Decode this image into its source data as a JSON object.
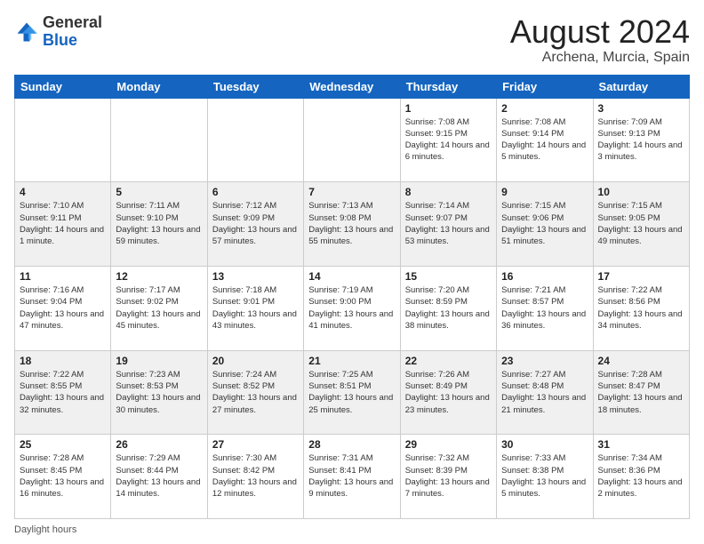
{
  "header": {
    "logo_general": "General",
    "logo_blue": "Blue",
    "month_year": "August 2024",
    "location": "Archena, Murcia, Spain"
  },
  "footer": {
    "daylight_label": "Daylight hours"
  },
  "weekdays": [
    "Sunday",
    "Monday",
    "Tuesday",
    "Wednesday",
    "Thursday",
    "Friday",
    "Saturday"
  ],
  "weeks": [
    [
      {
        "day": "",
        "info": ""
      },
      {
        "day": "",
        "info": ""
      },
      {
        "day": "",
        "info": ""
      },
      {
        "day": "",
        "info": ""
      },
      {
        "day": "1",
        "info": "Sunrise: 7:08 AM\nSunset: 9:15 PM\nDaylight: 14 hours\nand 6 minutes."
      },
      {
        "day": "2",
        "info": "Sunrise: 7:08 AM\nSunset: 9:14 PM\nDaylight: 14 hours\nand 5 minutes."
      },
      {
        "day": "3",
        "info": "Sunrise: 7:09 AM\nSunset: 9:13 PM\nDaylight: 14 hours\nand 3 minutes."
      }
    ],
    [
      {
        "day": "4",
        "info": "Sunrise: 7:10 AM\nSunset: 9:11 PM\nDaylight: 14 hours\nand 1 minute."
      },
      {
        "day": "5",
        "info": "Sunrise: 7:11 AM\nSunset: 9:10 PM\nDaylight: 13 hours\nand 59 minutes."
      },
      {
        "day": "6",
        "info": "Sunrise: 7:12 AM\nSunset: 9:09 PM\nDaylight: 13 hours\nand 57 minutes."
      },
      {
        "day": "7",
        "info": "Sunrise: 7:13 AM\nSunset: 9:08 PM\nDaylight: 13 hours\nand 55 minutes."
      },
      {
        "day": "8",
        "info": "Sunrise: 7:14 AM\nSunset: 9:07 PM\nDaylight: 13 hours\nand 53 minutes."
      },
      {
        "day": "9",
        "info": "Sunrise: 7:15 AM\nSunset: 9:06 PM\nDaylight: 13 hours\nand 51 minutes."
      },
      {
        "day": "10",
        "info": "Sunrise: 7:15 AM\nSunset: 9:05 PM\nDaylight: 13 hours\nand 49 minutes."
      }
    ],
    [
      {
        "day": "11",
        "info": "Sunrise: 7:16 AM\nSunset: 9:04 PM\nDaylight: 13 hours\nand 47 minutes."
      },
      {
        "day": "12",
        "info": "Sunrise: 7:17 AM\nSunset: 9:02 PM\nDaylight: 13 hours\nand 45 minutes."
      },
      {
        "day": "13",
        "info": "Sunrise: 7:18 AM\nSunset: 9:01 PM\nDaylight: 13 hours\nand 43 minutes."
      },
      {
        "day": "14",
        "info": "Sunrise: 7:19 AM\nSunset: 9:00 PM\nDaylight: 13 hours\nand 41 minutes."
      },
      {
        "day": "15",
        "info": "Sunrise: 7:20 AM\nSunset: 8:59 PM\nDaylight: 13 hours\nand 38 minutes."
      },
      {
        "day": "16",
        "info": "Sunrise: 7:21 AM\nSunset: 8:57 PM\nDaylight: 13 hours\nand 36 minutes."
      },
      {
        "day": "17",
        "info": "Sunrise: 7:22 AM\nSunset: 8:56 PM\nDaylight: 13 hours\nand 34 minutes."
      }
    ],
    [
      {
        "day": "18",
        "info": "Sunrise: 7:22 AM\nSunset: 8:55 PM\nDaylight: 13 hours\nand 32 minutes."
      },
      {
        "day": "19",
        "info": "Sunrise: 7:23 AM\nSunset: 8:53 PM\nDaylight: 13 hours\nand 30 minutes."
      },
      {
        "day": "20",
        "info": "Sunrise: 7:24 AM\nSunset: 8:52 PM\nDaylight: 13 hours\nand 27 minutes."
      },
      {
        "day": "21",
        "info": "Sunrise: 7:25 AM\nSunset: 8:51 PM\nDaylight: 13 hours\nand 25 minutes."
      },
      {
        "day": "22",
        "info": "Sunrise: 7:26 AM\nSunset: 8:49 PM\nDaylight: 13 hours\nand 23 minutes."
      },
      {
        "day": "23",
        "info": "Sunrise: 7:27 AM\nSunset: 8:48 PM\nDaylight: 13 hours\nand 21 minutes."
      },
      {
        "day": "24",
        "info": "Sunrise: 7:28 AM\nSunset: 8:47 PM\nDaylight: 13 hours\nand 18 minutes."
      }
    ],
    [
      {
        "day": "25",
        "info": "Sunrise: 7:28 AM\nSunset: 8:45 PM\nDaylight: 13 hours\nand 16 minutes."
      },
      {
        "day": "26",
        "info": "Sunrise: 7:29 AM\nSunset: 8:44 PM\nDaylight: 13 hours\nand 14 minutes."
      },
      {
        "day": "27",
        "info": "Sunrise: 7:30 AM\nSunset: 8:42 PM\nDaylight: 13 hours\nand 12 minutes."
      },
      {
        "day": "28",
        "info": "Sunrise: 7:31 AM\nSunset: 8:41 PM\nDaylight: 13 hours\nand 9 minutes."
      },
      {
        "day": "29",
        "info": "Sunrise: 7:32 AM\nSunset: 8:39 PM\nDaylight: 13 hours\nand 7 minutes."
      },
      {
        "day": "30",
        "info": "Sunrise: 7:33 AM\nSunset: 8:38 PM\nDaylight: 13 hours\nand 5 minutes."
      },
      {
        "day": "31",
        "info": "Sunrise: 7:34 AM\nSunset: 8:36 PM\nDaylight: 13 hours\nand 2 minutes."
      }
    ]
  ]
}
